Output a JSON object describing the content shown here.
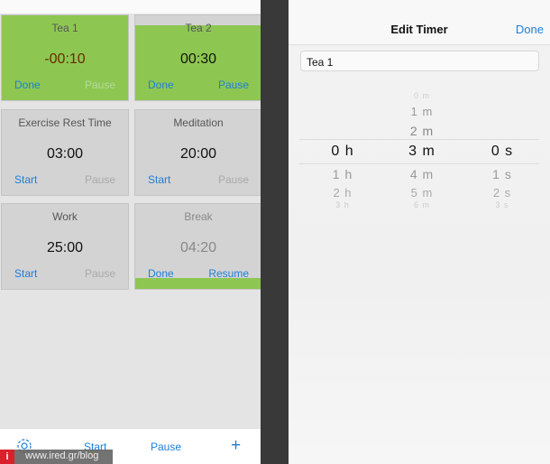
{
  "timers": [
    {
      "name": "Tea 1",
      "time": "-00:10",
      "left": "Done",
      "right": "Pause",
      "right_disabled": true,
      "progress": 1.0,
      "time_color": "#6b2a00"
    },
    {
      "name": "Tea 2",
      "time": "00:30",
      "left": "Done",
      "right": "Pause",
      "right_disabled": false,
      "progress": 0.88,
      "time_color": "#111111"
    },
    {
      "name": "Exercise Rest Time",
      "time": "03:00",
      "left": "Start",
      "right": "Pause",
      "right_disabled": true,
      "progress": 0,
      "time_color": "#111111"
    },
    {
      "name": "Meditation",
      "time": "20:00",
      "left": "Start",
      "right": "Pause",
      "right_disabled": true,
      "progress": 0,
      "time_color": "#111111"
    },
    {
      "name": "Work",
      "time": "25:00",
      "left": "Start",
      "right": "Pause",
      "right_disabled": true,
      "progress": 0,
      "time_color": "#111111"
    },
    {
      "name": "Break",
      "time": "04:20",
      "left": "Done",
      "right": "Resume",
      "right_disabled": false,
      "progress": 0.13,
      "time_color": "#888888",
      "name_color": "#888888"
    }
  ],
  "toolbar": {
    "settings_icon": "gear-icon",
    "start": "Start",
    "pause": "Pause",
    "add": "+"
  },
  "editor": {
    "title": "Edit Timer",
    "done": "Done",
    "name_value": "Tea 1",
    "hours": {
      "selected": "0 h",
      "below": [
        "1 h",
        "2 h",
        "3 h"
      ]
    },
    "minutes": {
      "above": [
        "0 m",
        "1 m",
        "2 m"
      ],
      "selected": "3 m",
      "below": [
        "4 m",
        "5 m",
        "6 m"
      ]
    },
    "seconds": {
      "selected": "0 s",
      "below": [
        "1 s",
        "2 s",
        "3 s"
      ]
    }
  },
  "watermark": {
    "badge": "i",
    "text": "www.ired.gr/blog"
  },
  "colors": {
    "accent": "#1e7ed8",
    "running": "#8dc752"
  }
}
